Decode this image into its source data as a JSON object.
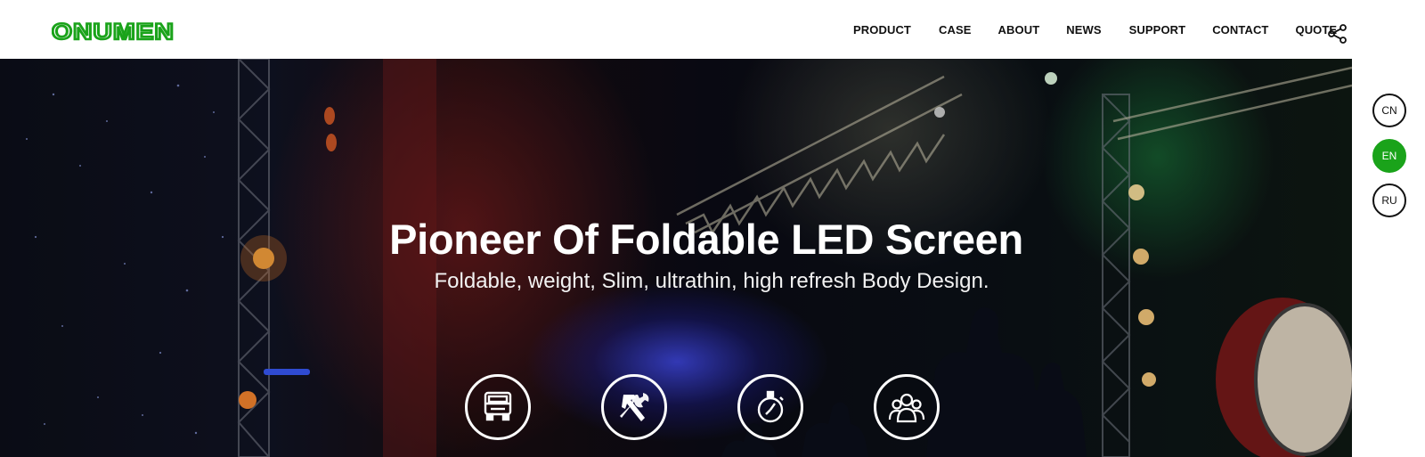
{
  "brand": {
    "name": "ONUMEN",
    "color": "#1aa31a"
  },
  "nav": {
    "items": [
      {
        "label": "PRODUCT"
      },
      {
        "label": "CASE"
      },
      {
        "label": "ABOUT"
      },
      {
        "label": "NEWS"
      },
      {
        "label": "SUPPORT"
      },
      {
        "label": "CONTACT"
      },
      {
        "label": "QUOTE"
      }
    ],
    "share_icon": "share-icon"
  },
  "hero": {
    "title": "Pioneer Of Foldable LED Screen",
    "subtitle": "Foldable, weight, Slim, ultrathin, high refresh Body Design.",
    "features": [
      {
        "icon": "truck-icon"
      },
      {
        "icon": "tools-icon"
      },
      {
        "icon": "stopwatch-icon"
      },
      {
        "icon": "people-icon"
      }
    ]
  },
  "languages": [
    {
      "code": "CN",
      "active": false
    },
    {
      "code": "EN",
      "active": true
    },
    {
      "code": "RU",
      "active": false
    }
  ]
}
